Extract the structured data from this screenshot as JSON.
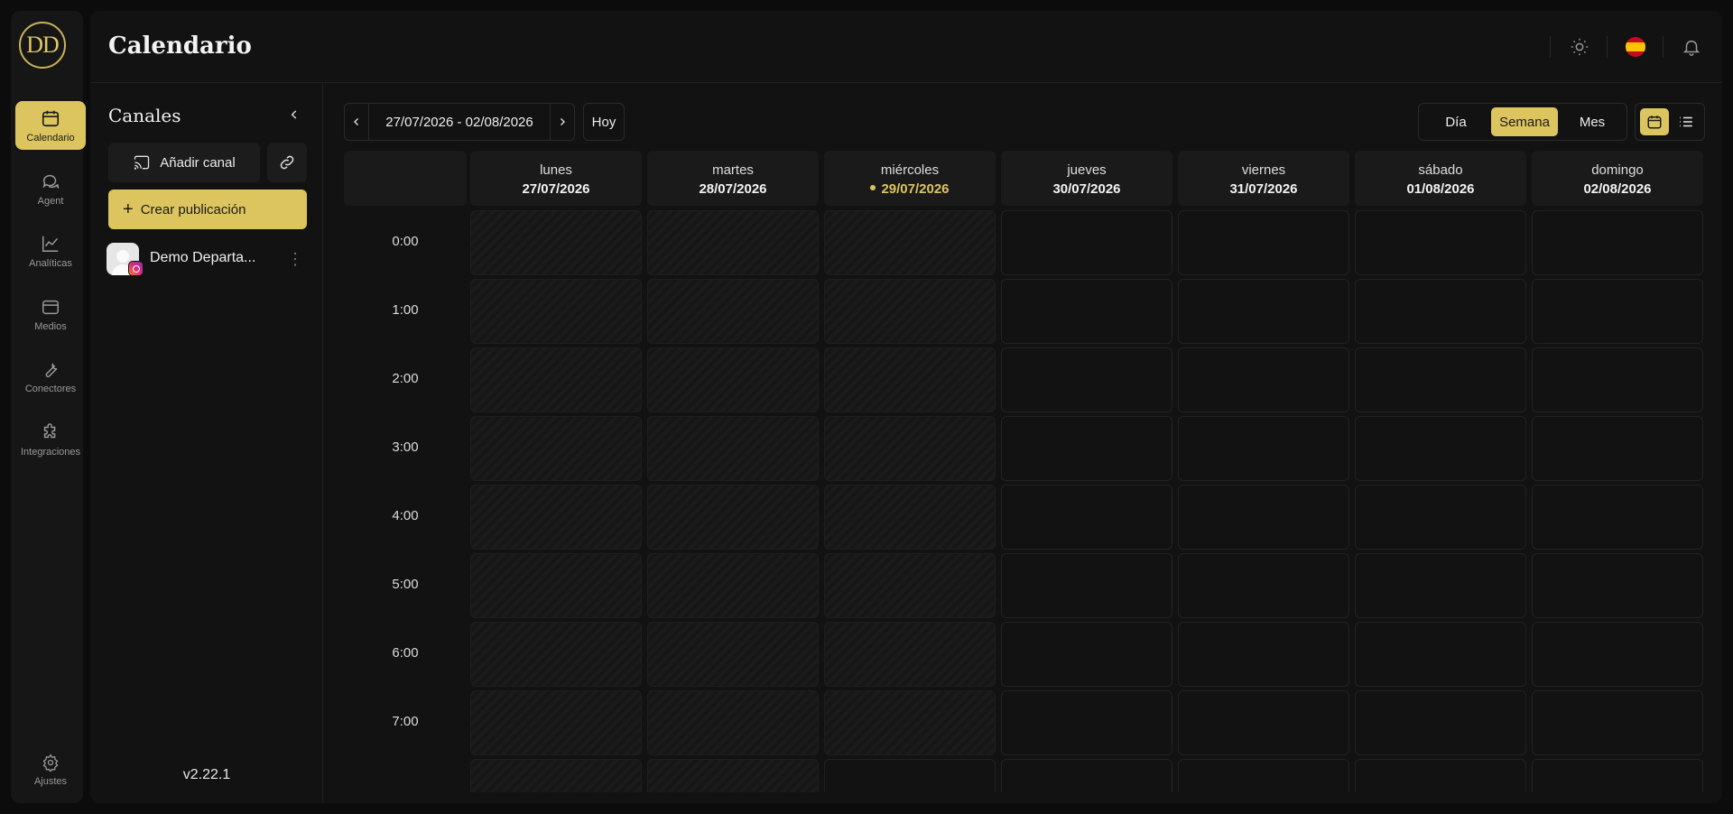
{
  "nav": {
    "logo": "DD",
    "items": [
      {
        "label": "Calendario",
        "icon": "calendar-icon"
      },
      {
        "label": "Agent",
        "icon": "chat-icon"
      },
      {
        "label": "Analíticas",
        "icon": "chart-line-icon"
      },
      {
        "label": "Medios",
        "icon": "media-icon"
      },
      {
        "label": "Conectores",
        "icon": "wrench-icon"
      },
      {
        "label": "Integraciones",
        "icon": "puzzle-icon"
      },
      {
        "label": "Ajustes",
        "icon": "gear-icon"
      }
    ]
  },
  "header": {
    "title": "Calendario",
    "icons": [
      "sun-icon",
      "spain-flag-icon",
      "bell-icon"
    ]
  },
  "channels": {
    "title": "Canales",
    "add_label": "Añadir canal",
    "create_label": "Crear publicación",
    "items": [
      {
        "name": "Demo Departa...",
        "network": "instagram"
      }
    ],
    "version": "v2.22.1"
  },
  "calendar": {
    "range": "27/07/2026 - 02/08/2026",
    "today_label": "Hoy",
    "views": [
      "Día",
      "Semana",
      "Mes"
    ],
    "active_view": "Semana",
    "days": [
      {
        "name": "lunes",
        "date": "27/07/2026"
      },
      {
        "name": "martes",
        "date": "28/07/2026"
      },
      {
        "name": "miércoles",
        "date": "29/07/2026"
      },
      {
        "name": "jueves",
        "date": "30/07/2026"
      },
      {
        "name": "viernes",
        "date": "31/07/2026"
      },
      {
        "name": "sábado",
        "date": "01/08/2026"
      },
      {
        "name": "domingo",
        "date": "02/08/2026"
      }
    ],
    "today_index": 2,
    "hours": [
      "0:00",
      "1:00",
      "2:00",
      "3:00",
      "4:00",
      "5:00",
      "6:00",
      "7:00"
    ]
  },
  "colors": {
    "accent": "#dcc55e",
    "background": "#0c0c0c",
    "panel": "#121212"
  }
}
